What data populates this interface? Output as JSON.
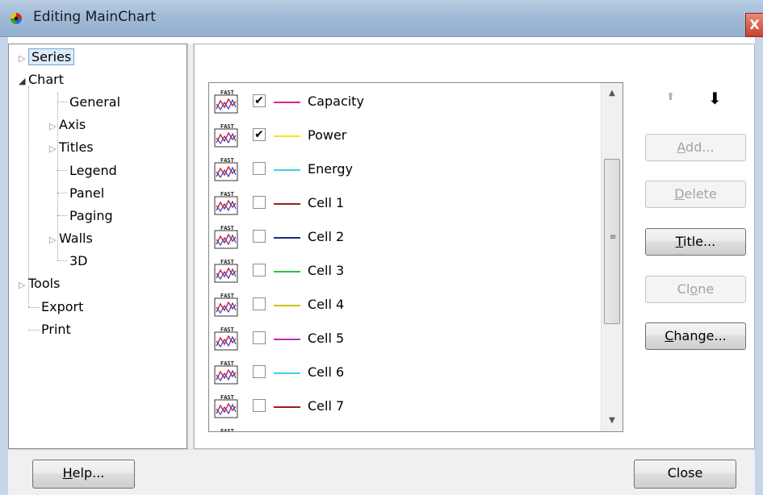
{
  "window": {
    "title": "Editing MainChart",
    "close_glyph": "X"
  },
  "tree": {
    "items": [
      {
        "label": "Series",
        "arrow": "▷"
      },
      {
        "label": "Chart",
        "arrow": "◢"
      },
      {
        "label": "General"
      },
      {
        "label": "Axis",
        "arrow": "▷"
      },
      {
        "label": "Titles",
        "arrow": "▷"
      },
      {
        "label": "Legend"
      },
      {
        "label": "Panel"
      },
      {
        "label": "Paging"
      },
      {
        "label": "Walls",
        "arrow": "▷"
      },
      {
        "label": "3D"
      },
      {
        "label": "Tools",
        "arrow": "▷"
      },
      {
        "label": "Export"
      },
      {
        "label": "Print"
      }
    ]
  },
  "series_list": {
    "icon_text": "FAST",
    "rows": [
      {
        "name": "Capacity",
        "checked": true,
        "check_glyph": "✔",
        "color": "#e0208a"
      },
      {
        "name": "Power",
        "checked": true,
        "check_glyph": "✔",
        "color": "#f5e21a"
      },
      {
        "name": "Energy",
        "checked": false,
        "check_glyph": "",
        "color": "#3dd5dd"
      },
      {
        "name": "Cell 1",
        "checked": false,
        "check_glyph": "",
        "color": "#9c1c1c"
      },
      {
        "name": "Cell 2",
        "checked": false,
        "check_glyph": "",
        "color": "#1c2a8c"
      },
      {
        "name": "Cell 3",
        "checked": false,
        "check_glyph": "",
        "color": "#2fbd3e"
      },
      {
        "name": "Cell 4",
        "checked": false,
        "check_glyph": "",
        "color": "#c8c41a"
      },
      {
        "name": "Cell 5",
        "checked": false,
        "check_glyph": "",
        "color": "#c22ac2"
      },
      {
        "name": "Cell 6",
        "checked": false,
        "check_glyph": "",
        "color": "#3dd5dd"
      },
      {
        "name": "Cell 7",
        "checked": false,
        "check_glyph": "",
        "color": "#9c1c1c"
      }
    ]
  },
  "buttons": {
    "add": {
      "pre": "",
      "u": "A",
      "post": "dd..."
    },
    "delete": {
      "pre": "",
      "u": "D",
      "post": "elete"
    },
    "title": {
      "pre": "",
      "u": "T",
      "post": "itle..."
    },
    "clone": {
      "pre": "Cl",
      "u": "o",
      "post": "ne"
    },
    "change": {
      "pre": "",
      "u": "C",
      "post": "hange..."
    },
    "help": {
      "pre": "",
      "u": "H",
      "post": "elp..."
    },
    "close": "Close"
  },
  "move": {
    "up_glyph": "⬆",
    "down_glyph": "⬇"
  }
}
